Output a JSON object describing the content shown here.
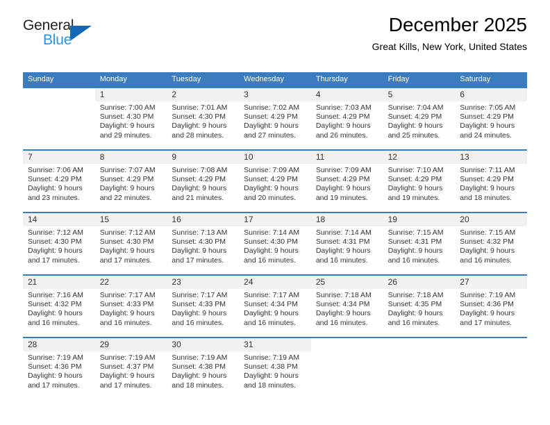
{
  "brand": {
    "name_top": "General",
    "name_bottom": "Blue",
    "accent_color": "#2e91e0",
    "triangle_color": "#1567b5"
  },
  "header": {
    "title": "December 2025",
    "subtitle": "Great Kills, New York, United States",
    "header_bg": "#3b7cbe",
    "daynum_band_bg": "#f1f1f1"
  },
  "weekdays": [
    "Sunday",
    "Monday",
    "Tuesday",
    "Wednesday",
    "Thursday",
    "Friday",
    "Saturday"
  ],
  "weeks": [
    [
      {
        "day": "",
        "sunrise": "",
        "sunset": "",
        "daylight_1": "",
        "daylight_2": ""
      },
      {
        "day": "1",
        "sunrise": "Sunrise: 7:00 AM",
        "sunset": "Sunset: 4:30 PM",
        "daylight_1": "Daylight: 9 hours",
        "daylight_2": "and 29 minutes."
      },
      {
        "day": "2",
        "sunrise": "Sunrise: 7:01 AM",
        "sunset": "Sunset: 4:30 PM",
        "daylight_1": "Daylight: 9 hours",
        "daylight_2": "and 28 minutes."
      },
      {
        "day": "3",
        "sunrise": "Sunrise: 7:02 AM",
        "sunset": "Sunset: 4:29 PM",
        "daylight_1": "Daylight: 9 hours",
        "daylight_2": "and 27 minutes."
      },
      {
        "day": "4",
        "sunrise": "Sunrise: 7:03 AM",
        "sunset": "Sunset: 4:29 PM",
        "daylight_1": "Daylight: 9 hours",
        "daylight_2": "and 26 minutes."
      },
      {
        "day": "5",
        "sunrise": "Sunrise: 7:04 AM",
        "sunset": "Sunset: 4:29 PM",
        "daylight_1": "Daylight: 9 hours",
        "daylight_2": "and 25 minutes."
      },
      {
        "day": "6",
        "sunrise": "Sunrise: 7:05 AM",
        "sunset": "Sunset: 4:29 PM",
        "daylight_1": "Daylight: 9 hours",
        "daylight_2": "and 24 minutes."
      }
    ],
    [
      {
        "day": "7",
        "sunrise": "Sunrise: 7:06 AM",
        "sunset": "Sunset: 4:29 PM",
        "daylight_1": "Daylight: 9 hours",
        "daylight_2": "and 23 minutes."
      },
      {
        "day": "8",
        "sunrise": "Sunrise: 7:07 AM",
        "sunset": "Sunset: 4:29 PM",
        "daylight_1": "Daylight: 9 hours",
        "daylight_2": "and 22 minutes."
      },
      {
        "day": "9",
        "sunrise": "Sunrise: 7:08 AM",
        "sunset": "Sunset: 4:29 PM",
        "daylight_1": "Daylight: 9 hours",
        "daylight_2": "and 21 minutes."
      },
      {
        "day": "10",
        "sunrise": "Sunrise: 7:09 AM",
        "sunset": "Sunset: 4:29 PM",
        "daylight_1": "Daylight: 9 hours",
        "daylight_2": "and 20 minutes."
      },
      {
        "day": "11",
        "sunrise": "Sunrise: 7:09 AM",
        "sunset": "Sunset: 4:29 PM",
        "daylight_1": "Daylight: 9 hours",
        "daylight_2": "and 19 minutes."
      },
      {
        "day": "12",
        "sunrise": "Sunrise: 7:10 AM",
        "sunset": "Sunset: 4:29 PM",
        "daylight_1": "Daylight: 9 hours",
        "daylight_2": "and 19 minutes."
      },
      {
        "day": "13",
        "sunrise": "Sunrise: 7:11 AM",
        "sunset": "Sunset: 4:29 PM",
        "daylight_1": "Daylight: 9 hours",
        "daylight_2": "and 18 minutes."
      }
    ],
    [
      {
        "day": "14",
        "sunrise": "Sunrise: 7:12 AM",
        "sunset": "Sunset: 4:30 PM",
        "daylight_1": "Daylight: 9 hours",
        "daylight_2": "and 17 minutes."
      },
      {
        "day": "15",
        "sunrise": "Sunrise: 7:12 AM",
        "sunset": "Sunset: 4:30 PM",
        "daylight_1": "Daylight: 9 hours",
        "daylight_2": "and 17 minutes."
      },
      {
        "day": "16",
        "sunrise": "Sunrise: 7:13 AM",
        "sunset": "Sunset: 4:30 PM",
        "daylight_1": "Daylight: 9 hours",
        "daylight_2": "and 17 minutes."
      },
      {
        "day": "17",
        "sunrise": "Sunrise: 7:14 AM",
        "sunset": "Sunset: 4:30 PM",
        "daylight_1": "Daylight: 9 hours",
        "daylight_2": "and 16 minutes."
      },
      {
        "day": "18",
        "sunrise": "Sunrise: 7:14 AM",
        "sunset": "Sunset: 4:31 PM",
        "daylight_1": "Daylight: 9 hours",
        "daylight_2": "and 16 minutes."
      },
      {
        "day": "19",
        "sunrise": "Sunrise: 7:15 AM",
        "sunset": "Sunset: 4:31 PM",
        "daylight_1": "Daylight: 9 hours",
        "daylight_2": "and 16 minutes."
      },
      {
        "day": "20",
        "sunrise": "Sunrise: 7:15 AM",
        "sunset": "Sunset: 4:32 PM",
        "daylight_1": "Daylight: 9 hours",
        "daylight_2": "and 16 minutes."
      }
    ],
    [
      {
        "day": "21",
        "sunrise": "Sunrise: 7:16 AM",
        "sunset": "Sunset: 4:32 PM",
        "daylight_1": "Daylight: 9 hours",
        "daylight_2": "and 16 minutes."
      },
      {
        "day": "22",
        "sunrise": "Sunrise: 7:17 AM",
        "sunset": "Sunset: 4:33 PM",
        "daylight_1": "Daylight: 9 hours",
        "daylight_2": "and 16 minutes."
      },
      {
        "day": "23",
        "sunrise": "Sunrise: 7:17 AM",
        "sunset": "Sunset: 4:33 PM",
        "daylight_1": "Daylight: 9 hours",
        "daylight_2": "and 16 minutes."
      },
      {
        "day": "24",
        "sunrise": "Sunrise: 7:17 AM",
        "sunset": "Sunset: 4:34 PM",
        "daylight_1": "Daylight: 9 hours",
        "daylight_2": "and 16 minutes."
      },
      {
        "day": "25",
        "sunrise": "Sunrise: 7:18 AM",
        "sunset": "Sunset: 4:34 PM",
        "daylight_1": "Daylight: 9 hours",
        "daylight_2": "and 16 minutes."
      },
      {
        "day": "26",
        "sunrise": "Sunrise: 7:18 AM",
        "sunset": "Sunset: 4:35 PM",
        "daylight_1": "Daylight: 9 hours",
        "daylight_2": "and 16 minutes."
      },
      {
        "day": "27",
        "sunrise": "Sunrise: 7:19 AM",
        "sunset": "Sunset: 4:36 PM",
        "daylight_1": "Daylight: 9 hours",
        "daylight_2": "and 17 minutes."
      }
    ],
    [
      {
        "day": "28",
        "sunrise": "Sunrise: 7:19 AM",
        "sunset": "Sunset: 4:36 PM",
        "daylight_1": "Daylight: 9 hours",
        "daylight_2": "and 17 minutes."
      },
      {
        "day": "29",
        "sunrise": "Sunrise: 7:19 AM",
        "sunset": "Sunset: 4:37 PM",
        "daylight_1": "Daylight: 9 hours",
        "daylight_2": "and 17 minutes."
      },
      {
        "day": "30",
        "sunrise": "Sunrise: 7:19 AM",
        "sunset": "Sunset: 4:38 PM",
        "daylight_1": "Daylight: 9 hours",
        "daylight_2": "and 18 minutes."
      },
      {
        "day": "31",
        "sunrise": "Sunrise: 7:19 AM",
        "sunset": "Sunset: 4:38 PM",
        "daylight_1": "Daylight: 9 hours",
        "daylight_2": "and 18 minutes."
      },
      {
        "day": "",
        "sunrise": "",
        "sunset": "",
        "daylight_1": "",
        "daylight_2": ""
      },
      {
        "day": "",
        "sunrise": "",
        "sunset": "",
        "daylight_1": "",
        "daylight_2": ""
      },
      {
        "day": "",
        "sunrise": "",
        "sunset": "",
        "daylight_1": "",
        "daylight_2": ""
      }
    ]
  ]
}
